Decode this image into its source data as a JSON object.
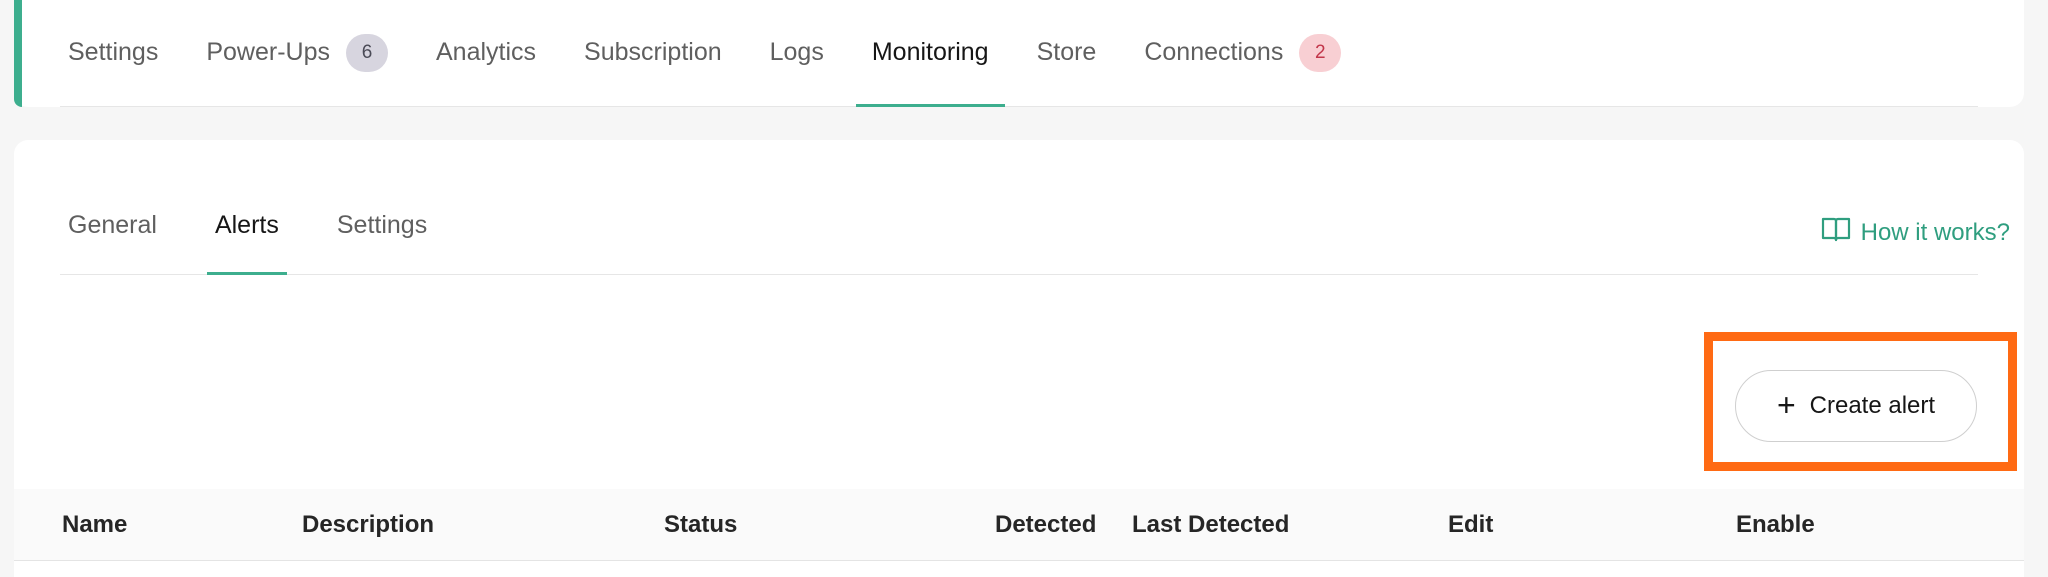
{
  "main_tabs": [
    {
      "label": "Settings"
    },
    {
      "label": "Power-Ups",
      "badge": "6"
    },
    {
      "label": "Analytics"
    },
    {
      "label": "Subscription"
    },
    {
      "label": "Logs"
    },
    {
      "label": "Monitoring",
      "active": true
    },
    {
      "label": "Store"
    },
    {
      "label": "Connections",
      "badge": "2"
    }
  ],
  "sub_tabs": [
    {
      "label": "General"
    },
    {
      "label": "Alerts",
      "active": true
    },
    {
      "label": "Settings"
    }
  ],
  "how_it_works": {
    "label": "How it works?",
    "icon": "book-icon"
  },
  "create_alert": {
    "label": "Create alert",
    "icon": "plus-icon"
  },
  "table": {
    "columns": [
      "Name",
      "Description",
      "Status",
      "Detected",
      "Last Detected",
      "Edit",
      "Enable"
    ]
  },
  "colors": {
    "accent": "#3dae8e",
    "highlight": "#ff6a13",
    "badge_grey": "#d7d5df",
    "badge_red": "#f8cfd3"
  }
}
